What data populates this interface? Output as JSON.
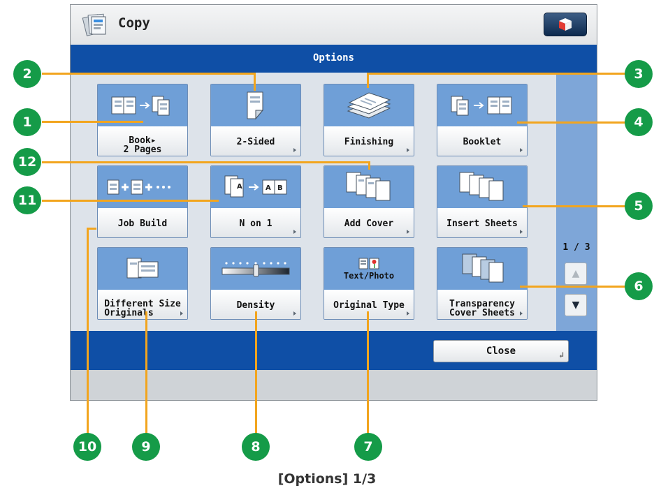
{
  "app": {
    "title": "Copy",
    "icon": "copy-app-icon",
    "home_icon": "home-cube-icon"
  },
  "header": {
    "title": "Options"
  },
  "tiles": [
    {
      "line1": "Book▸",
      "line2": "2 Pages",
      "icon": "book-to-pages-icon"
    },
    {
      "label": "2-Sided",
      "icon": "two-sided-icon"
    },
    {
      "label": "Finishing",
      "icon": "finishing-icon"
    },
    {
      "label": "Booklet",
      "icon": "booklet-icon"
    },
    {
      "label": "Job Build",
      "icon": "job-build-icon"
    },
    {
      "label": "N on 1",
      "icon": "n-on-1-icon",
      "page_a": "A",
      "page_b": "B"
    },
    {
      "label": "Add Cover",
      "icon": "add-cover-icon"
    },
    {
      "label": "Insert Sheets",
      "icon": "insert-sheets-icon"
    },
    {
      "line1": "Different Size",
      "line2": "Originals",
      "icon": "different-size-originals-icon"
    },
    {
      "label": "Density",
      "icon": "density-slider-icon"
    },
    {
      "label": "Original Type",
      "value": "Text/Photo",
      "icon": "text-photo-icon"
    },
    {
      "line1": "Transparency",
      "line2": "Cover Sheets",
      "icon": "transparency-cover-sheets-icon"
    }
  ],
  "pager": {
    "indicator": "1 / 3",
    "up": "▲",
    "down": "▼"
  },
  "footer": {
    "close_label": "Close",
    "close_arrow": "↲"
  },
  "callouts": [
    "1",
    "2",
    "3",
    "4",
    "5",
    "6",
    "7",
    "8",
    "9",
    "10",
    "11",
    "12"
  ],
  "caption": "[Options] 1/3",
  "colors": {
    "accent": "#0f4fa6",
    "tile_top": "#6f9fd7",
    "callout": "#159b48",
    "leader": "#f2a51e"
  }
}
